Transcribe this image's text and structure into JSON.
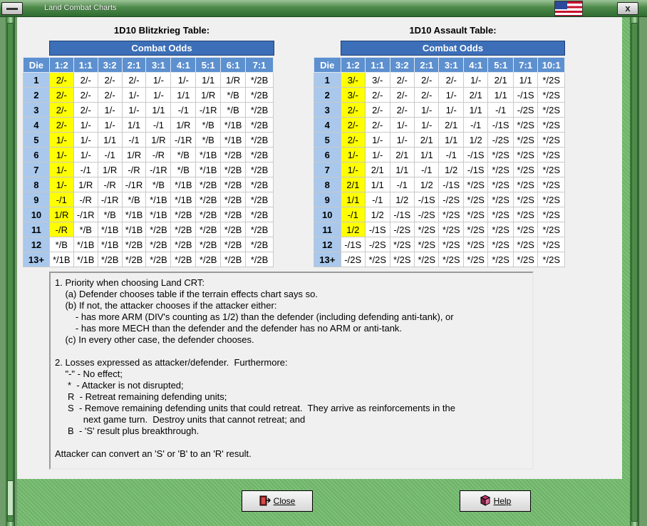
{
  "window": {
    "title": "Land Combat Charts",
    "flag_icon": "us-flag-icon",
    "close_glyph": "x"
  },
  "blitz": {
    "title": "1D10 Blitzkrieg Table:",
    "odds_header": "Combat Odds",
    "columns": [
      "Die",
      "1:2",
      "1:1",
      "3:2",
      "2:1",
      "3:1",
      "4:1",
      "5:1",
      "6:1",
      "7:1"
    ],
    "rows": [
      [
        "1",
        "2/-",
        "2/-",
        "2/-",
        "2/-",
        "1/-",
        "1/-",
        "1/1",
        "1/R",
        "*/2B"
      ],
      [
        "2",
        "2/-",
        "2/-",
        "2/-",
        "1/-",
        "1/-",
        "1/1",
        "1/R",
        "*/B",
        "*/2B"
      ],
      [
        "3",
        "2/-",
        "2/-",
        "1/-",
        "1/-",
        "1/1",
        "-/1",
        "-/1R",
        "*/B",
        "*/2B"
      ],
      [
        "4",
        "2/-",
        "1/-",
        "1/-",
        "1/1",
        "-/1",
        "1/R",
        "*/B",
        "*/1B",
        "*/2B"
      ],
      [
        "5",
        "1/-",
        "1/-",
        "1/1",
        "-/1",
        "1/R",
        "-/1R",
        "*/B",
        "*/1B",
        "*/2B"
      ],
      [
        "6",
        "1/-",
        "1/-",
        "-/1",
        "1/R",
        "-/R",
        "*/B",
        "*/1B",
        "*/2B",
        "*/2B"
      ],
      [
        "7",
        "1/-",
        "-/1",
        "1/R",
        "-/R",
        "-/1R",
        "*/B",
        "*/1B",
        "*/2B",
        "*/2B"
      ],
      [
        "8",
        "1/-",
        "1/R",
        "-/R",
        "-/1R",
        "*/B",
        "*/1B",
        "*/2B",
        "*/2B",
        "*/2B"
      ],
      [
        "9",
        "-/1",
        "-/R",
        "-/1R",
        "*/B",
        "*/1B",
        "*/1B",
        "*/2B",
        "*/2B",
        "*/2B"
      ],
      [
        "10",
        "1/R",
        "-/1R",
        "*/B",
        "*/1B",
        "*/1B",
        "*/2B",
        "*/2B",
        "*/2B",
        "*/2B"
      ],
      [
        "11",
        "-/R",
        "*/B",
        "*/1B",
        "*/1B",
        "*/2B",
        "*/2B",
        "*/2B",
        "*/2B",
        "*/2B"
      ],
      [
        "12",
        "*/B",
        "*/1B",
        "*/1B",
        "*/2B",
        "*/2B",
        "*/2B",
        "*/2B",
        "*/2B",
        "*/2B"
      ],
      [
        "13+",
        "*/1B",
        "*/1B",
        "*/2B",
        "*/2B",
        "*/2B",
        "*/2B",
        "*/2B",
        "*/2B",
        "*/2B"
      ]
    ]
  },
  "assault": {
    "title": "1D10 Assault Table:",
    "odds_header": "Combat Odds",
    "columns": [
      "Die",
      "1:2",
      "1:1",
      "3:2",
      "2:1",
      "3:1",
      "4:1",
      "5:1",
      "7:1",
      "10:1"
    ],
    "rows": [
      [
        "1",
        "3/-",
        "3/-",
        "2/-",
        "2/-",
        "2/-",
        "1/-",
        "2/1",
        "1/1",
        "*/2S"
      ],
      [
        "2",
        "3/-",
        "2/-",
        "2/-",
        "2/-",
        "1/-",
        "2/1",
        "1/1",
        "-/1S",
        "*/2S"
      ],
      [
        "3",
        "2/-",
        "2/-",
        "2/-",
        "1/-",
        "1/-",
        "1/1",
        "-/1",
        "-/2S",
        "*/2S"
      ],
      [
        "4",
        "2/-",
        "2/-",
        "1/-",
        "1/-",
        "2/1",
        "-/1",
        "-/1S",
        "*/2S",
        "*/2S"
      ],
      [
        "5",
        "2/-",
        "1/-",
        "1/-",
        "2/1",
        "1/1",
        "1/2",
        "-/2S",
        "*/2S",
        "*/2S"
      ],
      [
        "6",
        "1/-",
        "1/-",
        "2/1",
        "1/1",
        "-/1",
        "-/1S",
        "*/2S",
        "*/2S",
        "*/2S"
      ],
      [
        "7",
        "1/-",
        "2/1",
        "1/1",
        "-/1",
        "1/2",
        "-/1S",
        "*/2S",
        "*/2S",
        "*/2S"
      ],
      [
        "8",
        "2/1",
        "1/1",
        "-/1",
        "1/2",
        "-/1S",
        "*/2S",
        "*/2S",
        "*/2S",
        "*/2S"
      ],
      [
        "9",
        "1/1",
        "-/1",
        "1/2",
        "-/1S",
        "-/2S",
        "*/2S",
        "*/2S",
        "*/2S",
        "*/2S"
      ],
      [
        "10",
        "-/1",
        "1/2",
        "-/1S",
        "-/2S",
        "*/2S",
        "*/2S",
        "*/2S",
        "*/2S",
        "*/2S"
      ],
      [
        "11",
        "1/2",
        "-/1S",
        "-/2S",
        "*/2S",
        "*/2S",
        "*/2S",
        "*/2S",
        "*/2S",
        "*/2S"
      ],
      [
        "12",
        "-/1S",
        "-/2S",
        "*/2S",
        "*/2S",
        "*/2S",
        "*/2S",
        "*/2S",
        "*/2S",
        "*/2S"
      ],
      [
        "13+",
        "-/2S",
        "*/2S",
        "*/2S",
        "*/2S",
        "*/2S",
        "*/2S",
        "*/2S",
        "*/2S",
        "*/2S"
      ]
    ]
  },
  "highlight_color": "#ffff00",
  "header_color": "#5d90cf",
  "die_color": "#a9c8ec",
  "notes": [
    "1. Priority when choosing Land CRT:",
    "    (a) Defender chooses table if the terrain effects chart says so.",
    "    (b) If not, the attacker chooses if the attacker either:",
    "        - has more ARM (DIV's counting as 1/2) than the defender (including defending anti-tank), or",
    "        - has more MECH than the defender and the defender has no ARM or anti-tank.",
    "    (c) In every other case, the defender chooses.",
    "",
    "2. Losses expressed as attacker/defender.  Furthermore:",
    "    \"-\" - No effect;",
    "     *  - Attacker is not disrupted;",
    "     R  - Retreat remaining defending units;",
    "     S  - Remove remaining defending units that could retreat.  They arrive as reinforcements in the",
    "           next game turn.  Destroy units that cannot retreat; and",
    "     B  - 'S' result plus breakthrough.",
    "",
    "Attacker can convert an 'S' or 'B' to an 'R' result."
  ],
  "buttons": {
    "close": {
      "label": "Close",
      "icon": "close-door-icon"
    },
    "help": {
      "label": "Help",
      "icon": "help-book-icon"
    }
  }
}
